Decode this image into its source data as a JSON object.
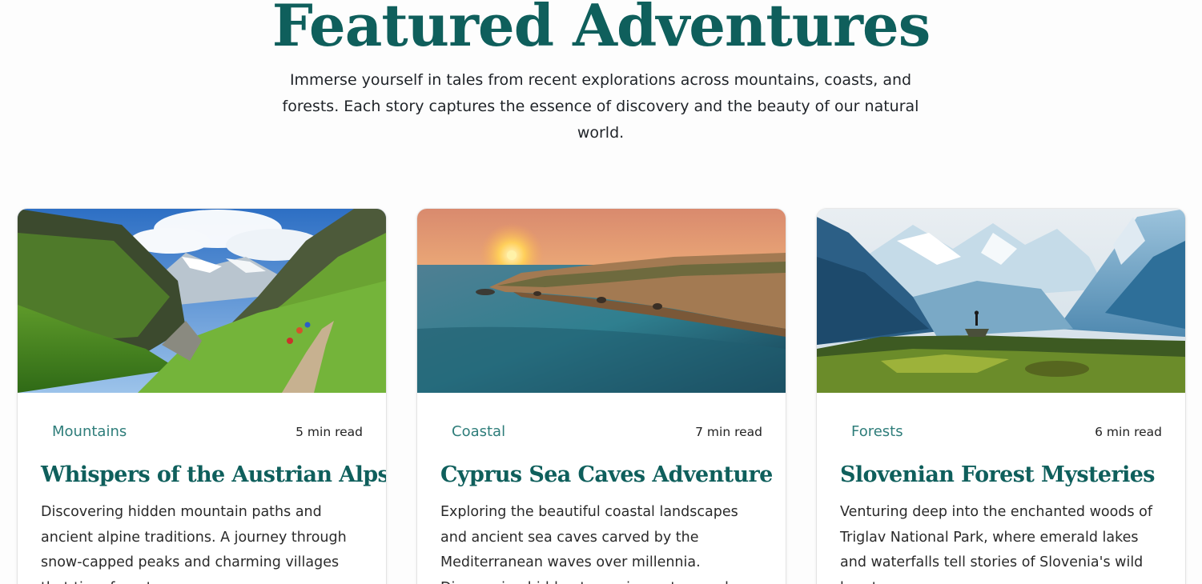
{
  "section": {
    "title": "Featured Adventures",
    "subtitle": "Immerse yourself in tales from recent explorations across mountains, coasts, and forests. Each story captures the essence of discovery and the beauty of our natural world."
  },
  "cards": [
    {
      "category": "Mountains",
      "read_time": "5 min read",
      "title": "Whispers of the Austrian Alps",
      "description": "Discovering hidden mountain paths and ancient alpine traditions. A journey through snow-capped peaks and charming villages that time forgot."
    },
    {
      "category": "Coastal",
      "read_time": "7 min read",
      "title": "Cyprus Sea Caves Adventure",
      "description": "Exploring the beautiful coastal landscapes and ancient sea caves carved by the Mediterranean waves over millennia. Discovering hidden turquoise waters and"
    },
    {
      "category": "Forests",
      "read_time": "6 min read",
      "title": "Slovenian Forest Mysteries",
      "description": "Venturing deep into the enchanted woods of Triglav National Park, where emerald lakes and waterfalls tell stories of Slovenia's wild heart."
    }
  ],
  "colors": {
    "accent": "#0f5f5c",
    "category": "#2e7d7a",
    "background": "#fdfdfd"
  }
}
